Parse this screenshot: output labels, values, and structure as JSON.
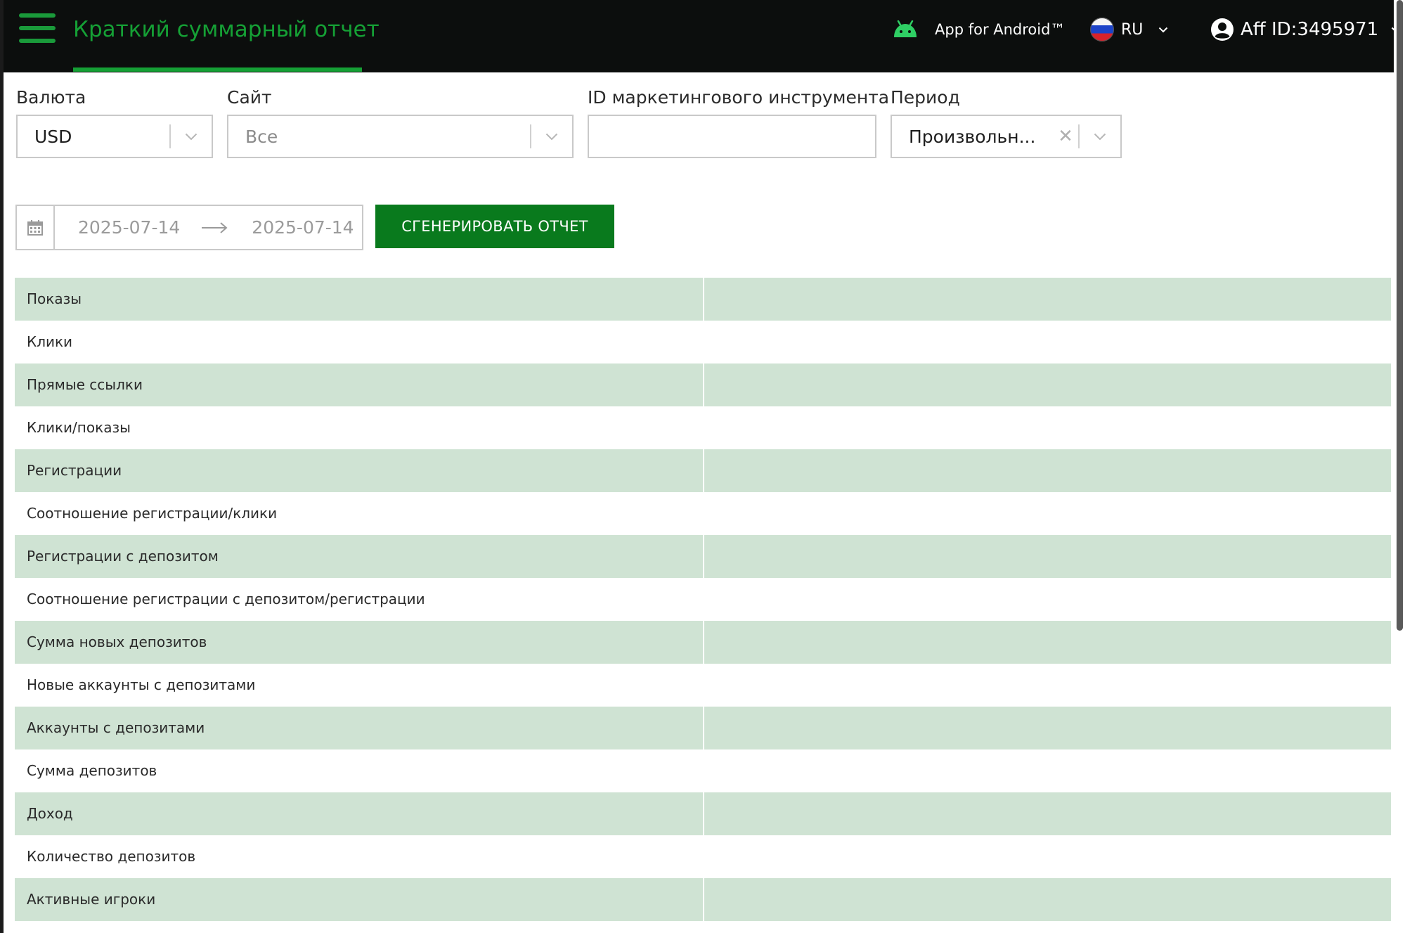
{
  "header": {
    "title": "Краткий суммарный отчет",
    "android_label": "App for Android™",
    "lang_label": "RU",
    "user_label": "Aff ID:3495971",
    "colors": {
      "background": "#0c0e0d",
      "accent": "#15a035"
    }
  },
  "filters": {
    "currency": {
      "label": "Валюта",
      "value": "USD"
    },
    "site": {
      "label": "Сайт",
      "value": "Все"
    },
    "marketing_id": {
      "label": "ID маркетингового инструмента",
      "value": "",
      "placeholder": ""
    },
    "period": {
      "label": "Период",
      "value": "Произвольн..."
    },
    "date_from": "2025-07-14",
    "date_to": "2025-07-14",
    "generate_label": "СГЕНЕРИРОВАТЬ ОТЧЕТ"
  },
  "report": {
    "row_color": "#cfe3d3",
    "rows": [
      {
        "label": "Показы",
        "value": ""
      },
      {
        "label": "Клики",
        "value": ""
      },
      {
        "label": "Прямые ссылки",
        "value": ""
      },
      {
        "label": "Клики/показы",
        "value": ""
      },
      {
        "label": "Регистрации",
        "value": ""
      },
      {
        "label": "Соотношение регистрации/клики",
        "value": ""
      },
      {
        "label": "Регистрации с депозитом",
        "value": ""
      },
      {
        "label": "Соотношение регистрации с депозитом/регистрации",
        "value": ""
      },
      {
        "label": "Сумма новых депозитов",
        "value": ""
      },
      {
        "label": "Новые аккаунты с депозитами",
        "value": ""
      },
      {
        "label": "Аккаунты с депозитами",
        "value": ""
      },
      {
        "label": "Сумма депозитов",
        "value": ""
      },
      {
        "label": "Доход",
        "value": ""
      },
      {
        "label": "Количество депозитов",
        "value": ""
      },
      {
        "label": "Активные игроки",
        "value": ""
      }
    ]
  }
}
